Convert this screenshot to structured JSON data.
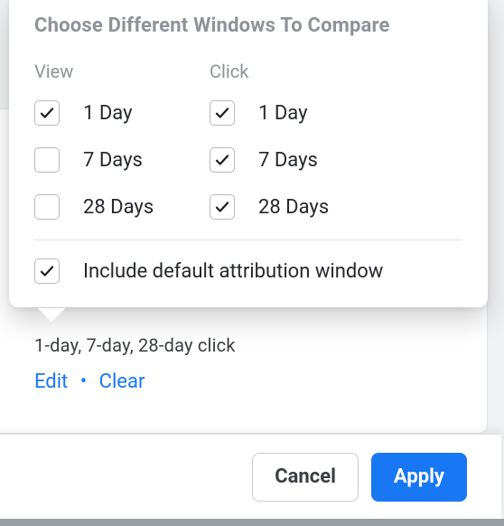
{
  "popover": {
    "title": "Choose Different Windows To Compare",
    "columns": {
      "view": {
        "header": "View",
        "options": [
          {
            "label": "1 Day",
            "checked": true
          },
          {
            "label": "7 Days",
            "checked": false
          },
          {
            "label": "28 Days",
            "checked": false
          }
        ]
      },
      "click": {
        "header": "Click",
        "options": [
          {
            "label": "1 Day",
            "checked": true
          },
          {
            "label": "7 Days",
            "checked": true
          },
          {
            "label": "28 Days",
            "checked": true
          }
        ]
      }
    },
    "include_default": {
      "label": "Include default attribution window",
      "checked": true
    }
  },
  "background": {
    "summary_text": "1-day, 7-day, 28-day click",
    "links": {
      "edit": "Edit",
      "clear": "Clear"
    }
  },
  "footer": {
    "cancel": "Cancel",
    "apply": "Apply"
  }
}
